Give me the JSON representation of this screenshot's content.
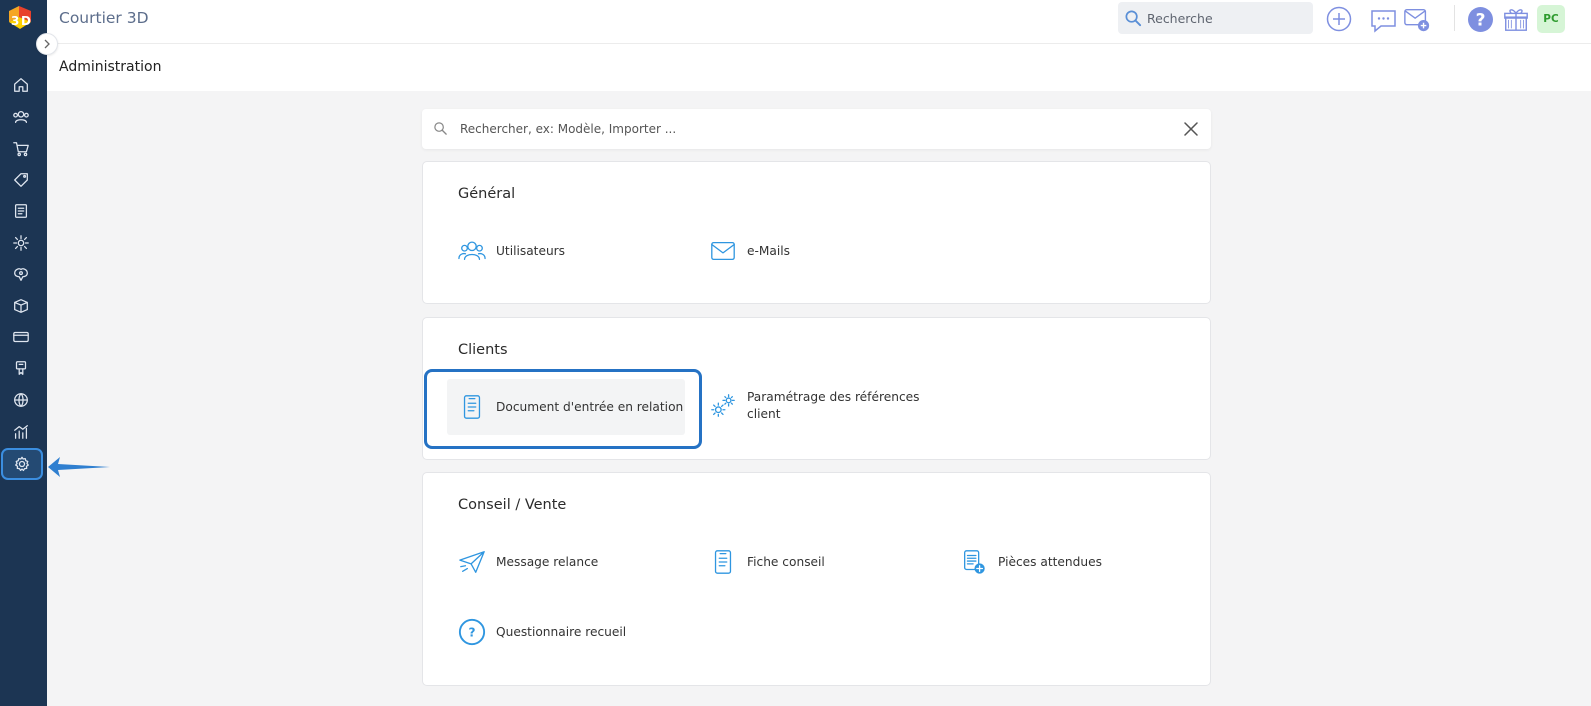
{
  "app": {
    "title": "Courtier 3D",
    "avatar_initials": "PC"
  },
  "header": {
    "search_placeholder": "Recherche",
    "icons": [
      "plus-circle-icon",
      "chat-icon",
      "mail-add-icon",
      "help-icon",
      "gift-icon"
    ]
  },
  "sidebar": {
    "items": [
      {
        "name": "home-icon"
      },
      {
        "name": "users-icon"
      },
      {
        "name": "cart-icon"
      },
      {
        "name": "tag-icon"
      },
      {
        "name": "document-icon"
      },
      {
        "name": "cog-icon"
      },
      {
        "name": "brain-icon"
      },
      {
        "name": "box-icon"
      },
      {
        "name": "card-icon"
      },
      {
        "name": "badge-icon"
      },
      {
        "name": "globe-icon"
      },
      {
        "name": "stats-icon"
      },
      {
        "name": "settings-icon",
        "active": true
      }
    ]
  },
  "page": {
    "title": "Administration",
    "search_placeholder": "Rechercher, ex: Modèle, Importer ..."
  },
  "sections": {
    "general": {
      "title": "Général",
      "items": [
        "Utilisateurs",
        "e-Mails"
      ]
    },
    "clients": {
      "title": "Clients",
      "items": [
        "Document d'entrée en relation",
        "Paramétrage des références",
        "client"
      ]
    },
    "conseil": {
      "title": "Conseil / Vente",
      "items": [
        "Message relance",
        "Fiche conseil",
        "Pièces attendues",
        "Questionnaire recueil"
      ]
    }
  },
  "colors": {
    "sidebar_bg": "#1c3553",
    "accent": "#2f96e0",
    "highlight_border": "#2572c4"
  }
}
